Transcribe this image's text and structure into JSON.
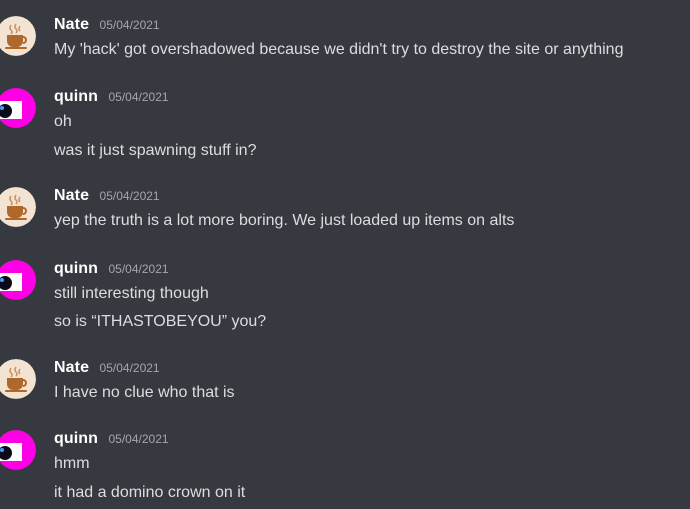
{
  "colors": {
    "background": "#36393f",
    "username": "#ffffff",
    "timestamp": "#a3a6aa",
    "message_text": "#dcddde",
    "nate_avatar_bg": "#f3e3d3",
    "nate_avatar_icon": "#b0682a",
    "quinn_avatar_bg": "#ff00e6",
    "quinn_avatar_eye": "#0a0a1a"
  },
  "messages": [
    {
      "author": "Nate",
      "avatar_icon": "coffee-cup-icon",
      "timestamp": "05/04/2021",
      "lines": [
        "My 'hack' got overshadowed because we didn't try to destroy the site or anything"
      ]
    },
    {
      "author": "quinn",
      "avatar_icon": "eye-icon",
      "timestamp": "05/04/2021",
      "lines": [
        "oh",
        "was it just spawning stuff in?"
      ]
    },
    {
      "author": "Nate",
      "avatar_icon": "coffee-cup-icon",
      "timestamp": "05/04/2021",
      "lines": [
        "yep the truth is a lot more boring. We just loaded up items on alts"
      ]
    },
    {
      "author": "quinn",
      "avatar_icon": "eye-icon",
      "timestamp": "05/04/2021",
      "lines": [
        "still interesting though",
        "so is “ITHASTOBEYOU” you?"
      ]
    },
    {
      "author": "Nate",
      "avatar_icon": "coffee-cup-icon",
      "timestamp": "05/04/2021",
      "lines": [
        "I have no clue who that is"
      ]
    },
    {
      "author": "quinn",
      "avatar_icon": "eye-icon",
      "timestamp": "05/04/2021",
      "lines": [
        "hmm",
        "it had a domino crown on it"
      ]
    }
  ]
}
